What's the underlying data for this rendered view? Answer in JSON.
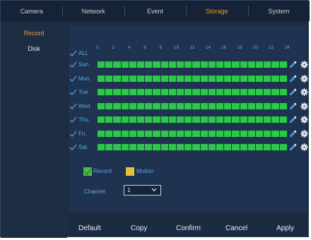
{
  "tabs": [
    {
      "label": "Camera",
      "active": false
    },
    {
      "label": "Network",
      "active": false
    },
    {
      "label": "Event",
      "active": false
    },
    {
      "label": "Storage",
      "active": true
    },
    {
      "label": "System",
      "active": false
    }
  ],
  "sidebar": {
    "items": [
      {
        "label": "Record",
        "active": true
      },
      {
        "label": "Disk",
        "active": false
      }
    ]
  },
  "schedule": {
    "all_label": "ALL",
    "hours": [
      "0",
      "2",
      "4",
      "6",
      "8",
      "10",
      "12",
      "14",
      "16",
      "18",
      "20",
      "22",
      "24"
    ],
    "days": [
      {
        "label": "Sun."
      },
      {
        "label": "Mon."
      },
      {
        "label": "Tue."
      },
      {
        "label": "Wed"
      },
      {
        "label": "Thu."
      },
      {
        "label": "Fri."
      },
      {
        "label": "Sat."
      }
    ],
    "segment_count": 24,
    "record_color": "#2bc947",
    "motion_color": "#e6c23a"
  },
  "legend": {
    "record_label": "Record",
    "motion_label": "Motion"
  },
  "channel": {
    "label": "Channel",
    "value": "1"
  },
  "buttons": {
    "default_label": "Default",
    "copy_label": "Copy",
    "confirm_label": "Confirm",
    "cancel_label": "Cancel",
    "apply_label": "Apply"
  },
  "colors": {
    "accent": "#e0a02a",
    "label_blue": "#5aa8e6",
    "panel": "#1f3350",
    "background": "#1b2b41"
  }
}
